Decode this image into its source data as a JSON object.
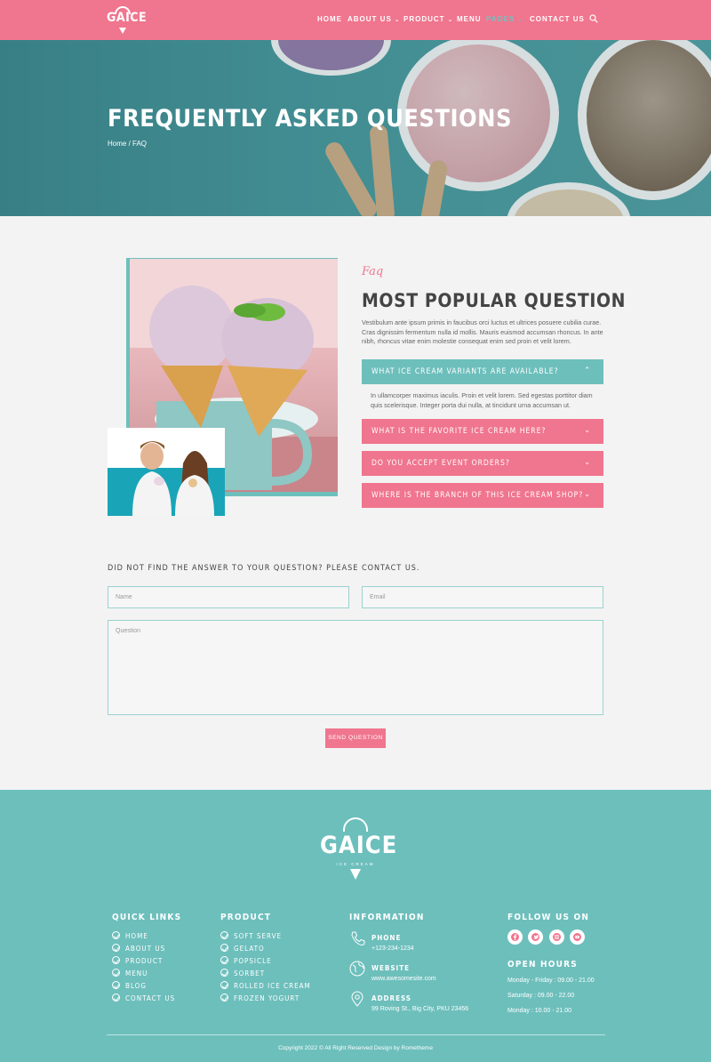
{
  "brand": {
    "name": "GAICE",
    "tagline": "ICE CREAM"
  },
  "nav": {
    "items": [
      {
        "label": "HOME",
        "dropdown": false,
        "active": false
      },
      {
        "label": "ABOUT US",
        "dropdown": true,
        "active": false
      },
      {
        "label": "PRODUCT",
        "dropdown": true,
        "active": false
      },
      {
        "label": "MENU",
        "dropdown": false,
        "active": false
      },
      {
        "label": "PAGES",
        "dropdown": true,
        "active": true
      },
      {
        "label": "CONTACT US",
        "dropdown": false,
        "active": false
      }
    ],
    "search_icon": "search-icon"
  },
  "hero": {
    "title": "FREQUENTLY ASKED QUESTIONS",
    "breadcrumb": "Home / FAQ"
  },
  "faq": {
    "eyebrow": "Faq",
    "title": "MOST POPULAR QUESTION",
    "description": "Vestibulum ante ipsum primis in faucibus orci luctus et ultrices posuere cubilia curae. Cras dignissim fermentum nulla id mollis. Mauris euismod accumsan rhoncus. In ante nibh, rhoncus vitae enim molestie consequat enim sed proin et velit lorem.",
    "items": [
      {
        "question": "WHAT ICE CREAM VARIANTS ARE AVAILABLE?",
        "open": true,
        "answer": "In ullamcorper maximus iaculis. Proin et velit lorem. Sed egestas porttitor diam quis scelerisque. Integer porta dui nulla, at tincidunt urna accumsan ut."
      },
      {
        "question": "WHAT IS THE FAVORITE ICE CREAM HERE?",
        "open": false
      },
      {
        "question": "DO YOU ACCEPT EVENT ORDERS?",
        "open": false
      },
      {
        "question": "WHERE IS THE BRANCH OF THIS ICE CREAM SHOP?",
        "open": false
      }
    ]
  },
  "contact_form": {
    "title": "DID NOT FIND THE ANSWER TO YOUR QUESTION? PLEASE CONTACT US.",
    "name_placeholder": "Name",
    "email_placeholder": "Email",
    "question_placeholder": "Question",
    "submit_label": "SEND QUESTION"
  },
  "footer": {
    "quick_links": {
      "title": "QUICK LINKS",
      "items": [
        "HOME",
        "ABOUT US",
        "PRODUCT",
        "MENU",
        "BLOG",
        "CONTACT US"
      ]
    },
    "product": {
      "title": "PRODUCT",
      "items": [
        "SOFT SERVE",
        "GELATO",
        "POPSICLE",
        "SORBET",
        "ROLLED ICE CREAM",
        "FROZEN YOGURT"
      ]
    },
    "information": {
      "title": "INFORMATION",
      "phone_label": "PHONE",
      "phone": "+123-234-1234",
      "website_label": "WEBSITE",
      "website": "www.awesomesite.com",
      "address_label": "ADDRESS",
      "address": "99 Roving St., Big City, PKU 23456"
    },
    "follow": {
      "title": "FOLLOW US ON",
      "icons": [
        "facebook-icon",
        "twitter-icon",
        "instagram-icon",
        "youtube-icon"
      ]
    },
    "hours": {
      "title": "OPEN HOURS",
      "lines": [
        "Monday - Friday : 09.00 - 21.00",
        "Saturday : 09.00 - 22.00",
        "Monday : 10.00 - 21.00"
      ]
    },
    "copyright": "Copyright 2022 © All Right Reserved Design by Rometheme"
  },
  "colors": {
    "pink": "#f0758e",
    "teal": "#6dbfbc",
    "background": "#f3f3f3"
  }
}
